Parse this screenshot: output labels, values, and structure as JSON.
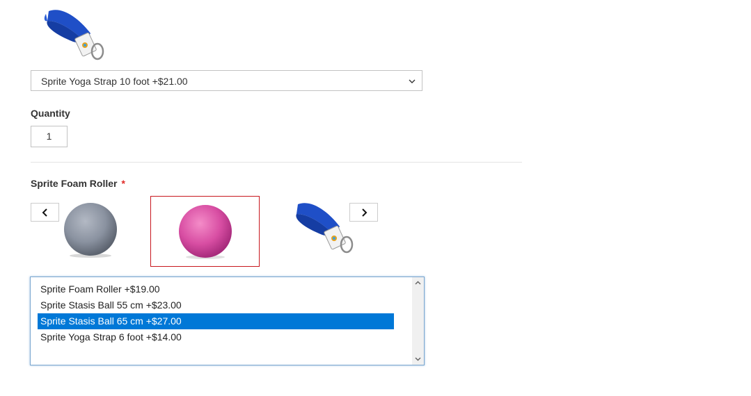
{
  "strap_select": {
    "selected": "Sprite Yoga Strap 10 foot +$21.00"
  },
  "quantity": {
    "label": "Quantity",
    "value": "1"
  },
  "foam_roller": {
    "label": "Sprite Foam Roller",
    "required_mark": "*",
    "carousel_images": [
      "grey-stasis-ball",
      "pink-stasis-ball",
      "blue-yoga-strap"
    ],
    "options": [
      "Sprite Foam Roller +$19.00",
      "Sprite Stasis Ball 55 cm +$23.00",
      "Sprite Stasis Ball 65 cm +$27.00",
      "Sprite Yoga Strap 6 foot +$14.00"
    ],
    "selected_index": 2
  },
  "colors": {
    "accent": "#0078d7",
    "required": "#e02b27",
    "selected_border": "#c7161d"
  }
}
